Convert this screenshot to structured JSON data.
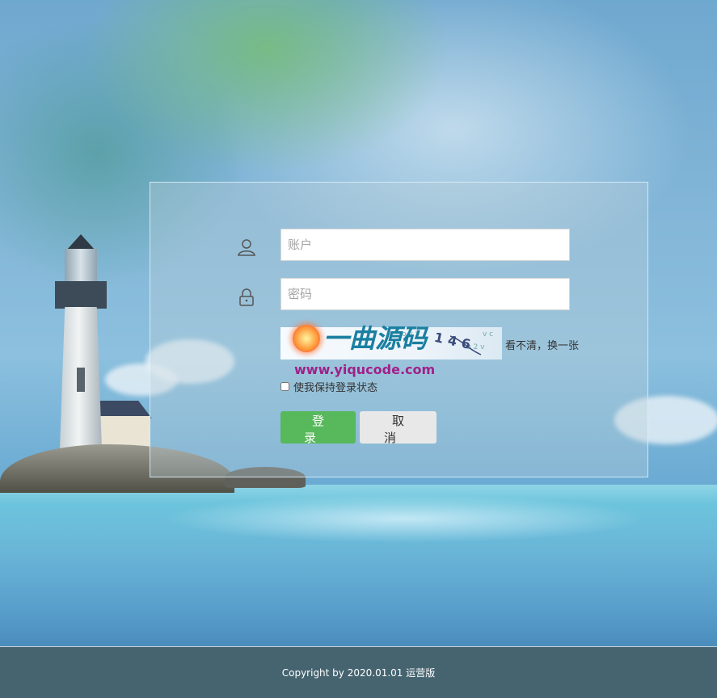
{
  "login": {
    "account_placeholder": "账户",
    "password_placeholder": "密码",
    "captcha_digits": "146",
    "refresh_label": "看不清，换一张",
    "remember_label": "使我保持登录状态",
    "login_label": "登录",
    "cancel_label": "取消"
  },
  "watermark": {
    "title": "一曲源码",
    "url": "www.yiqucode.com"
  },
  "footer": {
    "copyright": "Copyright by 2020.01.01 运营版"
  },
  "icons": {
    "account": "user-icon",
    "password": "lock-icon"
  },
  "colors": {
    "login_button": "#58b85c",
    "cancel_button": "#e8e8e8",
    "footer_bg": "#456470"
  }
}
